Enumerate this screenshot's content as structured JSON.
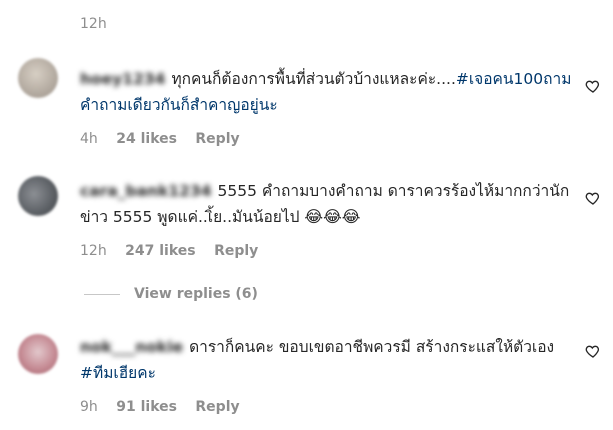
{
  "top_time": "12h",
  "comments": [
    {
      "username": "hoey1234",
      "text": "ทุกคนก็ต้องการพื้นที่ส่วนตัวบ้างแหละค่ะ....",
      "hashtag": "#เจอคน100ถามคำถามเดียวกันก็สำคาญอยู่นะ",
      "emoji": "",
      "time": "4h",
      "likes": "24 likes",
      "reply": "Reply"
    },
    {
      "username": "cara_bank1234",
      "text": "5555 คำถามบางคำถาม ดาราควรร้องไห้มากกว่านักข่าว 5555 พูดแค่..เิ้ย..มันน้อยไป",
      "hashtag": "",
      "emoji": "😂😂😂",
      "time": "12h",
      "likes": "247 likes",
      "reply": "Reply"
    },
    {
      "username": "nok___nokie",
      "text": "ดาราก็คนคะ ขอบเขตอาชีพควรมี สร้างกระแสให้ตัวเอง",
      "hashtag": "#ทีมเฮียคะ",
      "emoji": "",
      "time": "9h",
      "likes": "91 likes",
      "reply": "Reply"
    }
  ],
  "view_replies": "View replies (6)",
  "icons": {
    "like": "heart-outline-icon"
  }
}
